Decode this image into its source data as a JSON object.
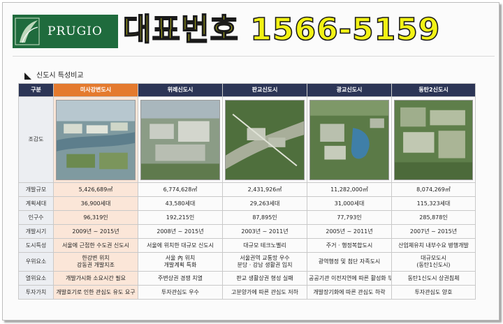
{
  "header": {
    "logo_text": "PRUGIO",
    "headline": "대표번호 1566-5159"
  },
  "section": {
    "title": "신도시 특성비교"
  },
  "table": {
    "corner": "구분",
    "columns": [
      "미사강변도시",
      "위례신도시",
      "판교신도시",
      "광교신도시",
      "동탄2신도시"
    ],
    "map_row_label": "조감도",
    "rows": [
      {
        "label": "개발규모",
        "cells": [
          "5,426,689㎡",
          "6,774,628㎡",
          "2,431,926㎡",
          "11,282,000㎡",
          "8,074,269㎡"
        ]
      },
      {
        "label": "계획세대",
        "cells": [
          "36,900세대",
          "43,580세대",
          "29,263세대",
          "31,000세대",
          "115,323세대"
        ]
      },
      {
        "label": "인구수",
        "cells": [
          "96,319인",
          "192,215인",
          "87,895인",
          "77,793인",
          "285,878인"
        ]
      },
      {
        "label": "개발시기",
        "cells": [
          "2009년 ~ 2015년",
          "2008년 ~ 2015년",
          "2003년 ~ 2011년",
          "2005년 ~ 2011년",
          "2007년 ~ 2015년"
        ]
      },
      {
        "label": "도시특성",
        "cells": [
          "서울에 근접한 수도권 신도시",
          "서울에 위치한 대규모 신도시",
          "대규모 테크노벨리",
          "주거 · 행정복합도시",
          "산업체유치 내부수요 병행개발"
        ]
      },
      {
        "label": "우위요소",
        "tall": true,
        "cells": [
          "한강변 위치\n강동권 개발지조",
          "서울 內 위치\n개발계획 특화",
          "서울권역 교통망 우수\n분당 · 강남 생활권 입지",
          "광역행정 및 첨단 자족도시",
          "대규모도시\n(동탄1신도시)"
        ]
      },
      {
        "label": "열위요소",
        "cells": [
          "개발가시화 소요시간 필요",
          "주변상권 경쟁 치열",
          "판교 생활상권 형성 실패",
          "공공기관 이전지연에 따른 활성화 부재",
          "동탄1신도시 상권침체"
        ]
      },
      {
        "label": "투자가치",
        "cells": [
          "개발호기로 인한 관심도 유도 요구",
          "투자관심도 우수",
          "고분양가에 따른 관심도 저하",
          "개발장기화에 따른 관심도 하락",
          "투자관심도 양호"
        ]
      }
    ]
  },
  "colors": {
    "brand_green": "#1f6b3d",
    "header_navy": "#2c3556",
    "highlight_orange": "#e47a2e",
    "highlight_cell": "#fbe6d8",
    "headline_yellow": "#f2f215"
  }
}
